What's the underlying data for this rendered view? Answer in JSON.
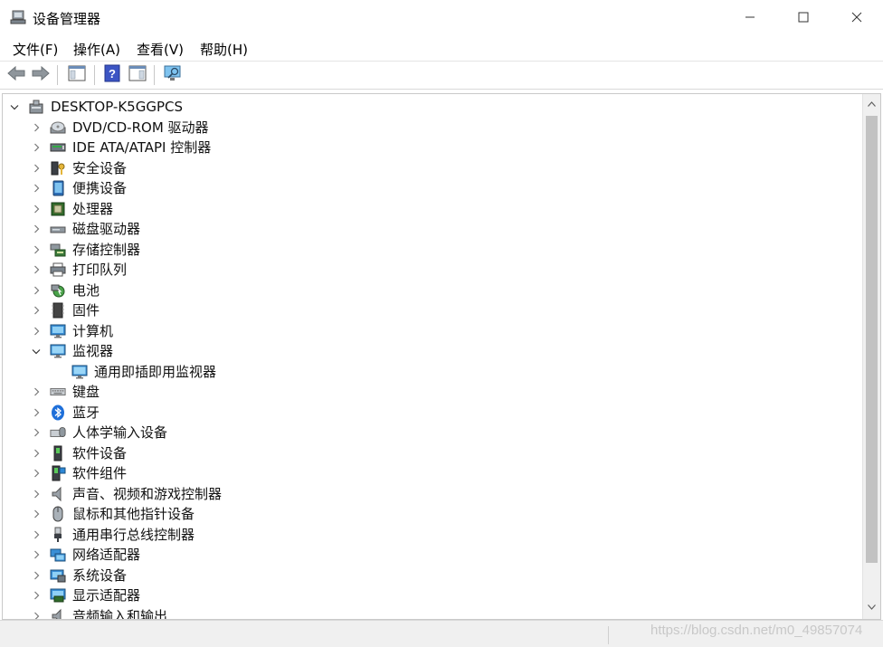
{
  "window": {
    "title": "设备管理器",
    "minimize_icon": "minimize-icon",
    "maximize_icon": "maximize-icon",
    "close_icon": "close-icon"
  },
  "menubar": {
    "items": [
      {
        "label": "文件(F)"
      },
      {
        "label": "操作(A)"
      },
      {
        "label": "查看(V)"
      },
      {
        "label": "帮助(H)"
      }
    ]
  },
  "toolbar": {
    "buttons": [
      "back-arrow-icon",
      "forward-arrow-icon",
      "properties-pane-icon",
      "help-icon",
      "show-hide-pane-icon",
      "scan-hardware-icon"
    ]
  },
  "tree": {
    "root": {
      "label": "DESKTOP-K5GGPCS",
      "icon": "computer-tower-icon",
      "expanded": true
    },
    "items": [
      {
        "label": "DVD/CD-ROM 驱动器",
        "icon": "dvd-drive-icon"
      },
      {
        "label": "IDE ATA/ATAPI 控制器",
        "icon": "ide-controller-icon"
      },
      {
        "label": "安全设备",
        "icon": "security-key-icon"
      },
      {
        "label": "便携设备",
        "icon": "portable-device-icon"
      },
      {
        "label": "处理器",
        "icon": "processor-icon"
      },
      {
        "label": "磁盘驱动器",
        "icon": "disk-drive-icon"
      },
      {
        "label": "存储控制器",
        "icon": "storage-controller-icon"
      },
      {
        "label": "打印队列",
        "icon": "printer-icon"
      },
      {
        "label": "电池",
        "icon": "battery-icon"
      },
      {
        "label": "固件",
        "icon": "firmware-icon"
      },
      {
        "label": "计算机",
        "icon": "computer-monitor-icon"
      },
      {
        "label": "监视器",
        "icon": "monitor-icon",
        "expanded": true,
        "children": [
          {
            "label": "通用即插即用监视器",
            "icon": "monitor-icon"
          }
        ]
      },
      {
        "label": "键盘",
        "icon": "keyboard-icon"
      },
      {
        "label": "蓝牙",
        "icon": "bluetooth-icon"
      },
      {
        "label": "人体学输入设备",
        "icon": "hid-icon"
      },
      {
        "label": "软件设备",
        "icon": "software-device-icon"
      },
      {
        "label": "软件组件",
        "icon": "software-component-icon"
      },
      {
        "label": "声音、视频和游戏控制器",
        "icon": "speaker-icon"
      },
      {
        "label": "鼠标和其他指针设备",
        "icon": "mouse-icon"
      },
      {
        "label": "通用串行总线控制器",
        "icon": "usb-icon"
      },
      {
        "label": "网络适配器",
        "icon": "network-adapter-icon"
      },
      {
        "label": "系统设备",
        "icon": "system-device-icon"
      },
      {
        "label": "显示适配器",
        "icon": "display-adapter-icon"
      },
      {
        "label": "音频输入和输出",
        "icon": "audio-io-icon"
      }
    ]
  },
  "watermark": "https://blog.csdn.net/m0_49857074",
  "colors": {
    "accent_blue": "#1e90e0",
    "tree_text": "#111111",
    "statusbar_bg": "#f0f0f0"
  }
}
